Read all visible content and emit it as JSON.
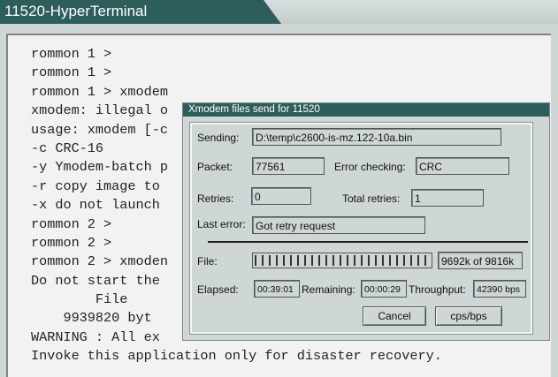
{
  "window": {
    "title": "11520-HyperTerminal"
  },
  "terminal": {
    "lines": [
      "rommon 1 >",
      "rommon 1 >",
      "rommon 1 > xmodem",
      "xmodem: illegal o",
      "usage: xmodem [-c",
      "-c CRC-16",
      "-y Ymodem-batch p",
      "-r copy image to",
      "-x do not launch",
      "rommon 2 >",
      "rommon 2 >",
      "rommon 2 > xmoden",
      "Do not start the",
      "        File",
      "    9939820 byt",
      "WARNING : All ex",
      "Invoke this application only for disaster recovery."
    ]
  },
  "dialog": {
    "title": "Xmodem files send for 11520",
    "sending_label": "Sending:",
    "sending_value": "D:\\temp\\c2600-is-mz.122-10a.bin",
    "packet_label": "Packet:",
    "packet_value": "77561",
    "error_checking_label": "Error checking:",
    "error_checking_value": "CRC",
    "retries_label": "Retries:",
    "retries_value": "0",
    "total_retries_label": "Total retries:",
    "total_retries_value": "1",
    "last_error_label": "Last error:",
    "last_error_value": "Got retry request",
    "file_label": "File:",
    "file_progress_text": "9692k of 9816k",
    "file_progress_fraction": 0.987,
    "elapsed_label": "Elapsed:",
    "elapsed_value": "00:39:01",
    "remaining_label": "Remaining:",
    "remaining_value": "00:00:29",
    "throughput_label": "Throughput:",
    "throughput_value": "42390 bps",
    "cancel_label": "Cancel",
    "cps_label": "cps/bps"
  }
}
